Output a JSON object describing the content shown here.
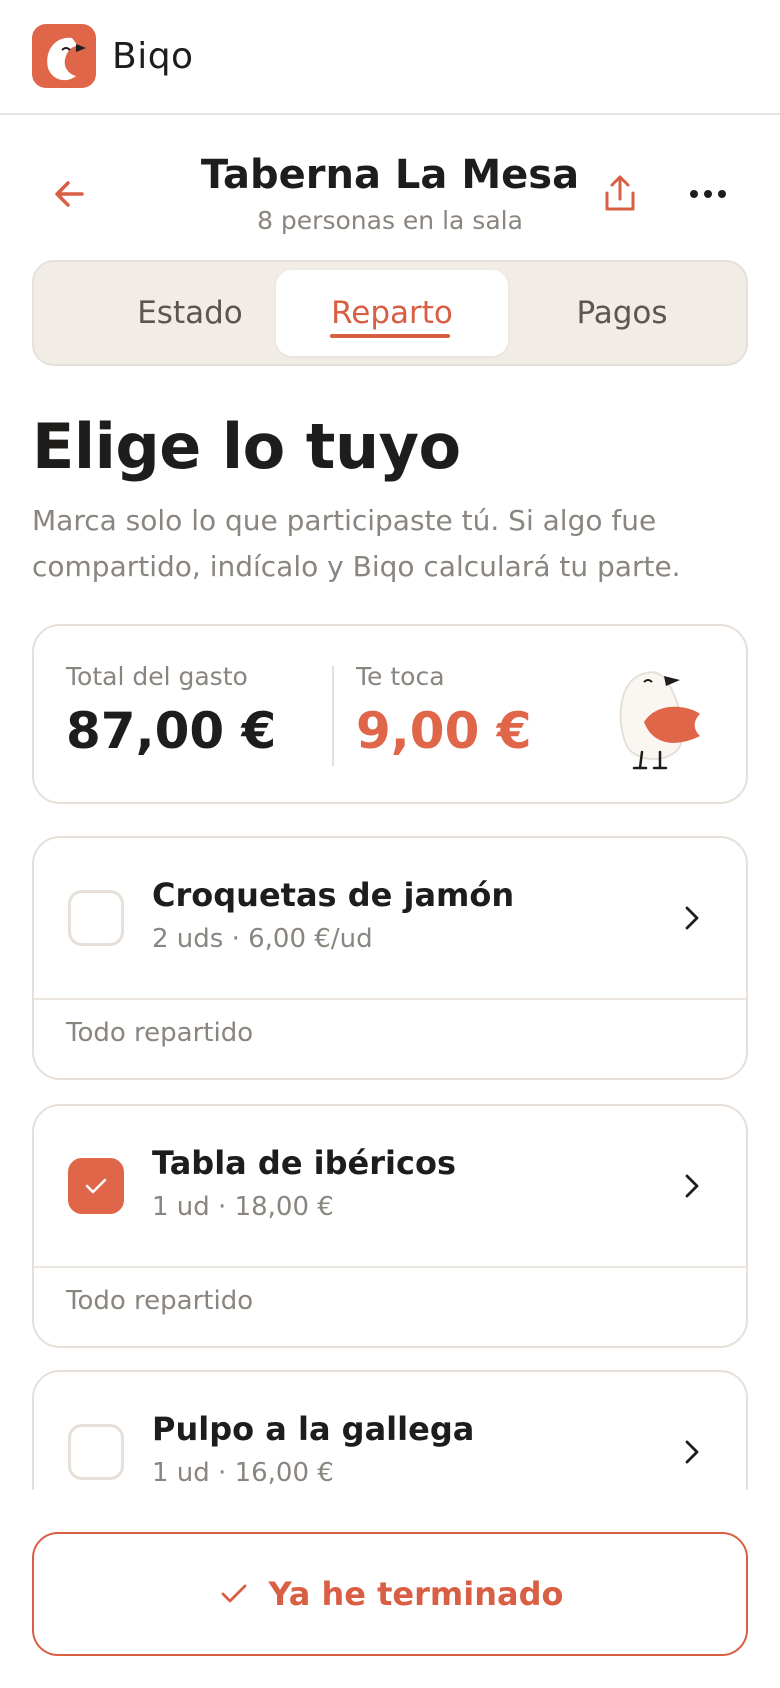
{
  "app": {
    "brand": "Biqo"
  },
  "header": {
    "title": "Taberna La Mesa",
    "subtitle": "8 personas en la sala"
  },
  "tabs": [
    {
      "label": "Estado",
      "active": false
    },
    {
      "label": "Reparto",
      "active": true
    },
    {
      "label": "Pagos",
      "active": false
    }
  ],
  "main": {
    "heading": "Elige lo tuyo",
    "intro": "Marca solo lo que participaste tú. Si algo fue compartido, indícalo y Biqo calculará tu parte."
  },
  "summary": {
    "total_label": "Total del gasto",
    "total_value": "87,00 €",
    "share_label": "Te toca",
    "share_value": "9,00 €"
  },
  "items": [
    {
      "name": "Croquetas de jamón",
      "meta": "2 uds · 6,00 €/ud",
      "status": "Todo repartido",
      "checked": false
    },
    {
      "name": "Tabla de ibéricos",
      "meta": "1 ud · 18,00 €",
      "status": "Todo repartido",
      "checked": true
    },
    {
      "name": "Pulpo a la gallega",
      "meta": "1 ud · 16,00 €",
      "status": "",
      "checked": false
    }
  ],
  "footer": {
    "done_label": "Ya he terminado"
  },
  "colors": {
    "accent": "#e0664a",
    "accent_text": "#d85f44",
    "muted": "#8a857f",
    "border": "#e6e0d8",
    "tab_bg": "#f1ece5"
  },
  "icons": [
    "app-logo",
    "back-arrow-icon",
    "share-icon",
    "more-icon",
    "mascot-bird",
    "checkmark-icon",
    "chevron-right-icon"
  ]
}
